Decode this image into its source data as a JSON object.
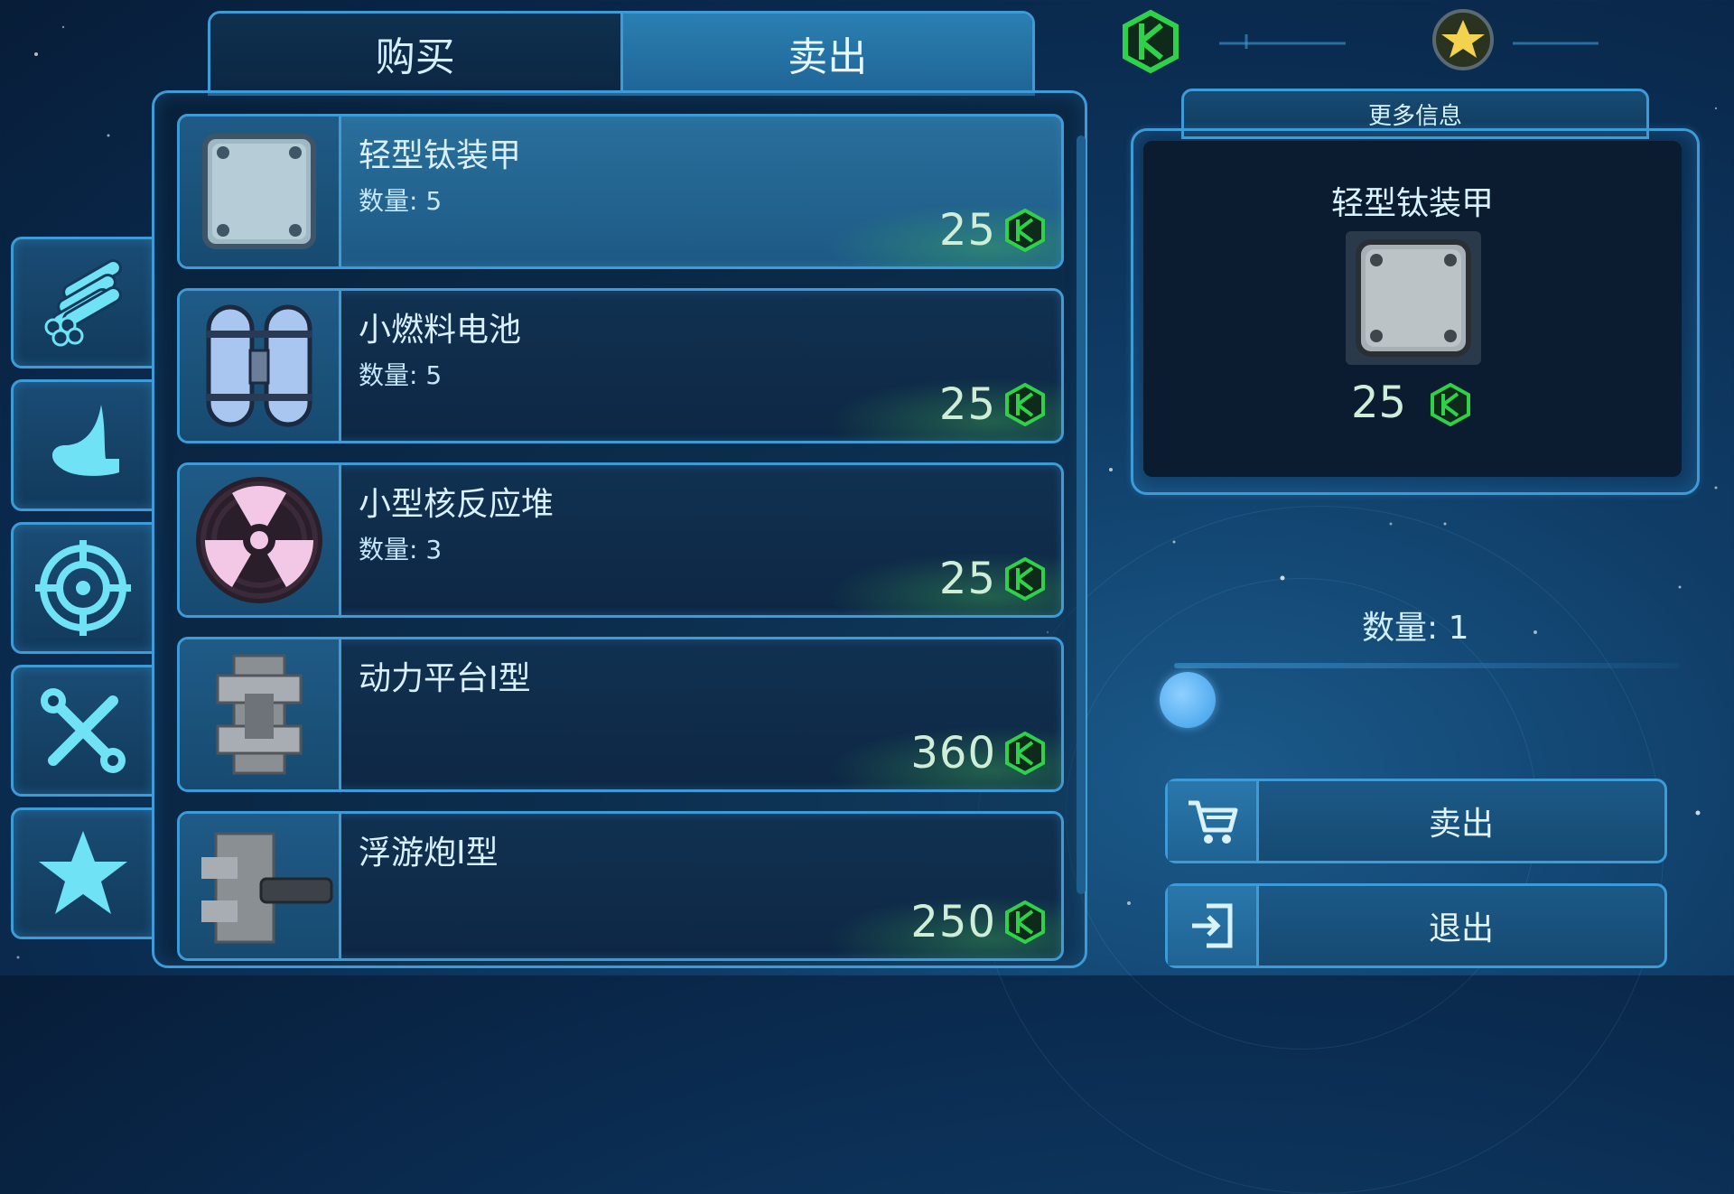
{
  "tabs": {
    "buy": "购买",
    "sell": "卖出",
    "active": "sell"
  },
  "categories": [
    {
      "name": "materials",
      "icon": "pipes-icon"
    },
    {
      "name": "weapons-melee",
      "icon": "claw-icon"
    },
    {
      "name": "targeting",
      "icon": "crosshair-icon"
    },
    {
      "name": "tools",
      "icon": "wrench-screwdriver-icon"
    },
    {
      "name": "favorites",
      "icon": "star-icon"
    }
  ],
  "items": [
    {
      "name": "轻型钛装甲",
      "qty": "数量: 5",
      "price": "25",
      "icon": "armor-plate-icon",
      "selected": true
    },
    {
      "name": "小燃料电池",
      "qty": "数量: 5",
      "price": "25",
      "icon": "fuel-cell-icon",
      "selected": false
    },
    {
      "name": "小型核反应堆",
      "qty": "数量: 3",
      "price": "25",
      "icon": "radiation-icon",
      "selected": false
    },
    {
      "name": "动力平台I型",
      "qty": "",
      "price": "360",
      "icon": "power-platform-icon",
      "selected": false
    },
    {
      "name": "浮游炮I型",
      "qty": "",
      "price": "250",
      "icon": "drone-cannon-icon",
      "selected": false
    }
  ],
  "detail": {
    "more_info": "更多信息",
    "name": "轻型钛装甲",
    "price": "25",
    "quantity_label": "数量: 1",
    "quantity": 1
  },
  "actions": {
    "sell": "卖出",
    "exit": "退出"
  },
  "colors": {
    "accent": "#3d9bd8",
    "currency": "#2fd04a",
    "bg": "#0f3c66"
  }
}
